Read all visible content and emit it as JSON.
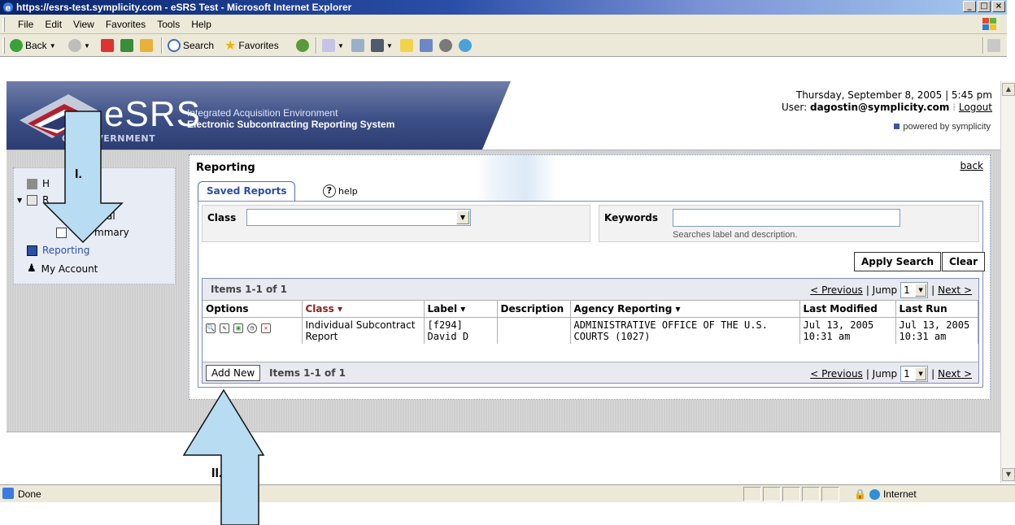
{
  "window": {
    "title": "https://esrs-test.symplicity.com - eSRS Test - Microsoft Internet Explorer",
    "minimize": "_",
    "maximize": "□",
    "close": "×"
  },
  "menu": [
    "File",
    "Edit",
    "View",
    "Favorites",
    "Tools",
    "Help"
  ],
  "toolbar": {
    "back": "Back",
    "search": "Search",
    "favorites": "Favorites"
  },
  "header": {
    "brand": "eSRS",
    "subtitle1": "Integrated Acquisition Environment",
    "subtitle2": "Electronic Subcontracting Reporting System",
    "gov": "OR GOVERNMENT",
    "datetime": "Thursday, September 8, 2005 | 5:45 pm",
    "user_label": "User:",
    "user": "dagostin@symplicity.com",
    "logout": "Logout",
    "powered": "powered by symplicity"
  },
  "nav": {
    "home": "H",
    "reports": "R",
    "individual": "al",
    "summary": "mmary",
    "reporting": "Reporting",
    "account": "My Account"
  },
  "panel": {
    "title": "Reporting",
    "back": "back",
    "tab": "Saved Reports",
    "help": "help",
    "class_label": "Class",
    "class_value": "",
    "keywords_label": "Keywords",
    "keywords_value": "",
    "keywords_hint": "Searches label and description.",
    "apply": "Apply Search",
    "clear": "Clear"
  },
  "results": {
    "items_top": "Items 1-1 of 1",
    "items_bottom": "Items 1-1 of 1",
    "previous": "< Previous",
    "jump": "| Jump",
    "jump_value": "1",
    "next": "Next >",
    "add_new": "Add New",
    "columns": [
      "Options",
      "Class ▾",
      "Label ▾",
      "Description",
      "Agency Reporting ▾",
      "Last Modified",
      "Last Run"
    ],
    "rows": [
      {
        "class": "Individual Subcontract Report",
        "label": "[f294] David D",
        "description": "",
        "agency": "ADMINISTRATIVE OFFICE OF THE U.S. COURTS (1027)",
        "last_modified": "Jul 13, 2005 10:31 am",
        "last_run": "Jul 13, 2005 10:31 am"
      }
    ]
  },
  "status": {
    "done": "Done",
    "zone": "Internet"
  },
  "annotations": {
    "one": "I.",
    "two": "II."
  }
}
